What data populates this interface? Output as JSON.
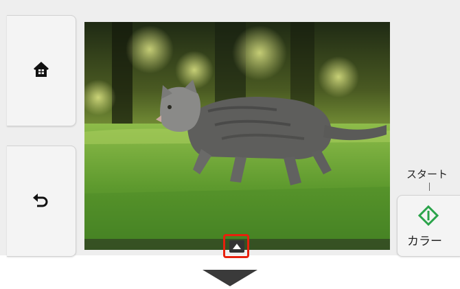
{
  "icons": {
    "home": "home-icon",
    "back": "back-arrow-icon",
    "scroll_up": "triangle-up-icon",
    "start_color": "diamond-start-icon",
    "scroll_down": "chevron-down-icon"
  },
  "colors": {
    "highlight": "#e8200c",
    "start_green": "#2aa34a",
    "panel_bg": "#eeeeee",
    "button_bg": "#f4f4f4"
  },
  "start_button": {
    "caption": "スタート",
    "label": "カラー"
  }
}
